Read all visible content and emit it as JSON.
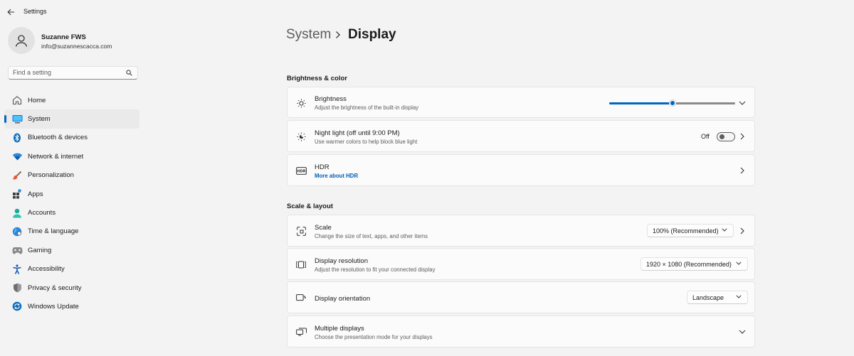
{
  "window": {
    "title": "Settings"
  },
  "profile": {
    "name": "Suzanne FWS",
    "email": "info@suzannescacca.com"
  },
  "search": {
    "placeholder": "Find a setting"
  },
  "nav": [
    {
      "label": "Home",
      "icon": "home-icon"
    },
    {
      "label": "System",
      "icon": "system-icon",
      "active": true
    },
    {
      "label": "Bluetooth & devices",
      "icon": "bluetooth-icon"
    },
    {
      "label": "Network & internet",
      "icon": "wifi-icon"
    },
    {
      "label": "Personalization",
      "icon": "brush-icon"
    },
    {
      "label": "Apps",
      "icon": "apps-icon"
    },
    {
      "label": "Accounts",
      "icon": "accounts-icon"
    },
    {
      "label": "Time & language",
      "icon": "globe-icon"
    },
    {
      "label": "Gaming",
      "icon": "gamepad-icon"
    },
    {
      "label": "Accessibility",
      "icon": "accessibility-icon"
    },
    {
      "label": "Privacy & security",
      "icon": "shield-icon"
    },
    {
      "label": "Windows Update",
      "icon": "update-icon"
    }
  ],
  "breadcrumb": {
    "parent": "System",
    "current": "Display"
  },
  "sections": {
    "brightness_color": {
      "title": "Brightness & color"
    },
    "scale_layout": {
      "title": "Scale & layout"
    }
  },
  "settings": {
    "brightness": {
      "title": "Brightness",
      "subtitle": "Adjust the brightness of the built-in display",
      "value_fraction": 0.5
    },
    "night_light": {
      "title": "Night light (off until 9:00 PM)",
      "subtitle": "Use warmer colors to help block blue light",
      "state": "Off"
    },
    "hdr": {
      "title": "HDR",
      "link": "More about HDR"
    },
    "scale": {
      "title": "Scale",
      "subtitle": "Change the size of text, apps, and other items",
      "value": "100% (Recommended)"
    },
    "resolution": {
      "title": "Display resolution",
      "subtitle": "Adjust the resolution to fit your connected display",
      "value": "1920 × 1080 (Recommended)"
    },
    "orientation": {
      "title": "Display orientation",
      "value": "Landscape"
    },
    "multiple_displays": {
      "title": "Multiple displays",
      "subtitle": "Choose the presentation mode for your displays"
    }
  },
  "colors": {
    "accent": "#0067c0",
    "link": "#005fb8",
    "background": "#f3f3f3",
    "card": "#fbfbfb"
  }
}
